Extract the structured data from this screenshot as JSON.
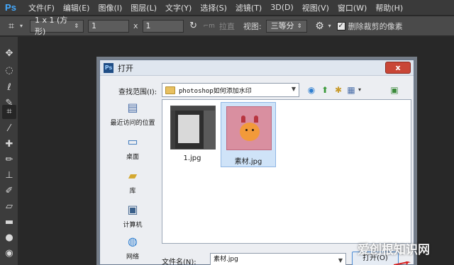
{
  "app": {
    "logo": "Ps"
  },
  "menu": [
    "文件(F)",
    "编辑(E)",
    "图像(I)",
    "图层(L)",
    "文字(Y)",
    "选择(S)",
    "滤镜(T)",
    "3D(D)",
    "视图(V)",
    "窗口(W)",
    "帮助(H)"
  ],
  "options": {
    "ratio": "1 x 1 (方形)",
    "width": "1",
    "times": "x",
    "height": "1",
    "straighten": "拉直",
    "view_label": "视图:",
    "view_value": "三等分",
    "delete_cropped": "删除裁剪的像素"
  },
  "dialog": {
    "title": "打开",
    "close": "x",
    "look_in_label": "查找范围(I):",
    "look_in_value": "photoshop如何添加水印",
    "places": [
      {
        "label": "最近访问的位置",
        "icon": "recent-places-icon"
      },
      {
        "label": "桌面",
        "icon": "desktop-icon"
      },
      {
        "label": "库",
        "icon": "libraries-icon"
      },
      {
        "label": "计算机",
        "icon": "computer-icon"
      },
      {
        "label": "网络",
        "icon": "network-icon"
      }
    ],
    "files": [
      {
        "name": "1.jpg",
        "selected": false
      },
      {
        "name": "素材.jpg",
        "selected": true
      }
    ],
    "filename_label": "文件名(N):",
    "filename_value": "素材.jpg",
    "open_button": "打开(O)"
  },
  "watermark": "爱创根知识网"
}
